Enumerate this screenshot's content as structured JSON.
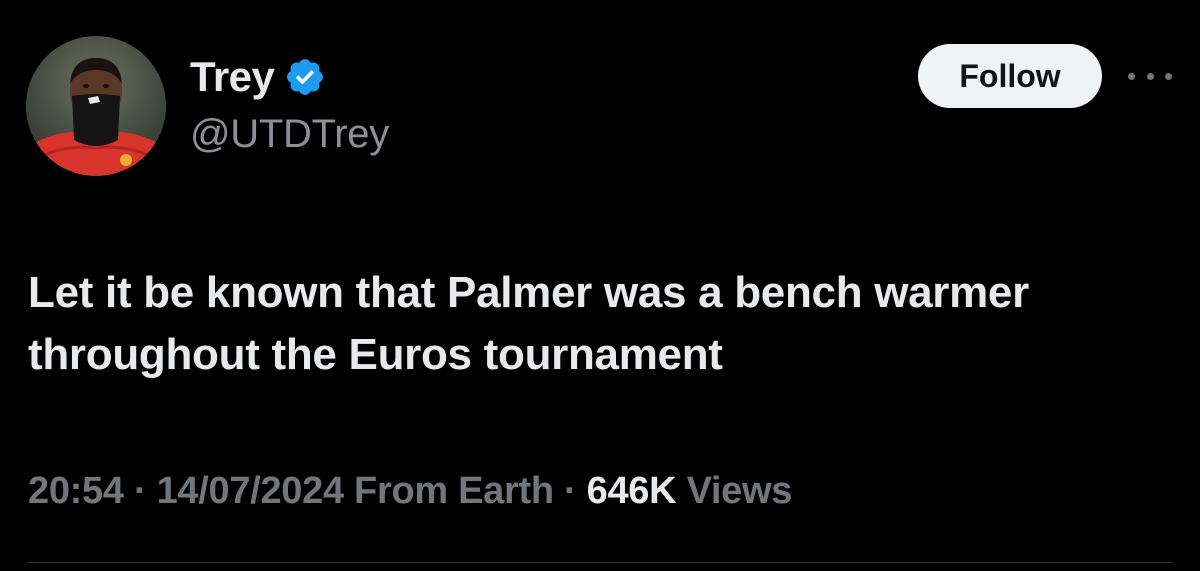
{
  "author": {
    "display_name": "Trey",
    "handle": "@UTDTrey",
    "verified": true
  },
  "actions": {
    "follow_label": "Follow",
    "more_icon": "more-horizontal-icon"
  },
  "tweet": {
    "text": "Let it be known that Palmer was a bench warmer throughout the Euros tournament",
    "time": "20:54",
    "date": "14/07/2024",
    "location": "From Earth",
    "separator": "·",
    "views_count": "646K",
    "views_label": "Views"
  },
  "colors": {
    "background": "#000000",
    "text_primary": "#e7e9ea",
    "text_secondary": "#71767b",
    "verified_blue": "#1d9bf0",
    "follow_button_bg": "#eff3f4"
  }
}
